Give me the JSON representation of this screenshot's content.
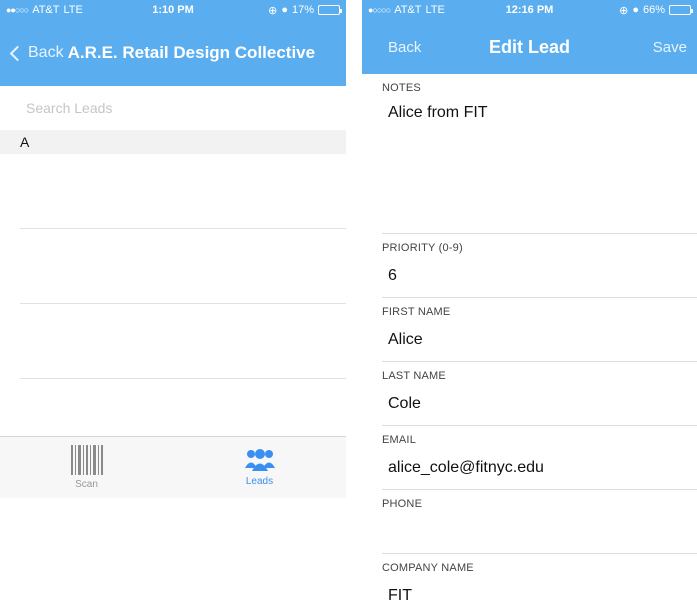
{
  "left_screen": {
    "status": {
      "carrier": "AT&T",
      "network": "LTE",
      "time": "1:10 PM",
      "battery": "17%",
      "battery_level": 0.17
    },
    "nav": {
      "back_label": "Back",
      "title": "A.R.E. Retail Design Collective"
    },
    "search": {
      "placeholder": "Search Leads"
    },
    "section_header": "A",
    "tabs": [
      {
        "label": "Scan",
        "icon": "barcode-icon"
      },
      {
        "label": "Leads",
        "icon": "people-icon"
      }
    ],
    "colors": {
      "nav_bar": "#5aaef0",
      "tab_active": "#3a8ff0"
    }
  },
  "right_screen": {
    "status": {
      "carrier": "AT&T",
      "network": "LTE",
      "time": "12:16 PM",
      "battery": "66%",
      "battery_level": 0.66
    },
    "nav": {
      "back_label": "Back",
      "title": "Edit Lead",
      "save_label": "Save"
    },
    "fields": {
      "notes": {
        "label": "NOTES",
        "value": "Alice from FIT"
      },
      "priority": {
        "label": "PRIORITY (0-9)",
        "value": "6"
      },
      "first_name": {
        "label": "FIRST NAME",
        "value": "Alice"
      },
      "last_name": {
        "label": "LAST NAME",
        "value": "Cole"
      },
      "email": {
        "label": "EMAIL",
        "value": "alice_cole@fitnyc.edu"
      },
      "phone": {
        "label": "PHONE",
        "value": ""
      },
      "company_name": {
        "label": "COMPANY NAME",
        "value": "FIT"
      }
    }
  }
}
